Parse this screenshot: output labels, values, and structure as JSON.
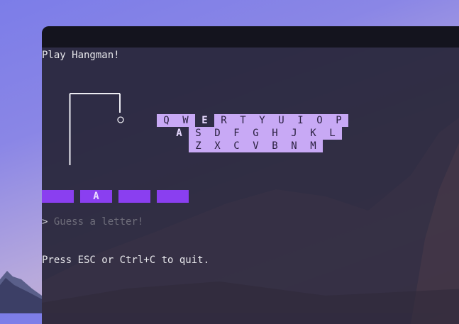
{
  "terminal": {
    "title": "Play Hangman!",
    "keyboard": {
      "rows": [
        [
          "Q",
          "W",
          "E",
          "R",
          "T",
          "Y",
          "U",
          "I",
          "O",
          "P"
        ],
        [
          "A",
          "S",
          "D",
          "F",
          "G",
          "H",
          "J",
          "K",
          "L"
        ],
        [
          "Z",
          "X",
          "C",
          "V",
          "B",
          "N",
          "M"
        ]
      ],
      "guessed": [
        "E",
        "A"
      ]
    },
    "word_slots": [
      "",
      "A",
      "",
      ""
    ],
    "prompt": {
      "symbol": ">",
      "placeholder": "Guess a letter!"
    },
    "quit_hint": "Press ESC or Ctrl+C to quit."
  },
  "colors": {
    "key_bg": "#c8a9f5",
    "slot_bg": "#8a3ff0",
    "terminal_bg": "#28263a"
  }
}
